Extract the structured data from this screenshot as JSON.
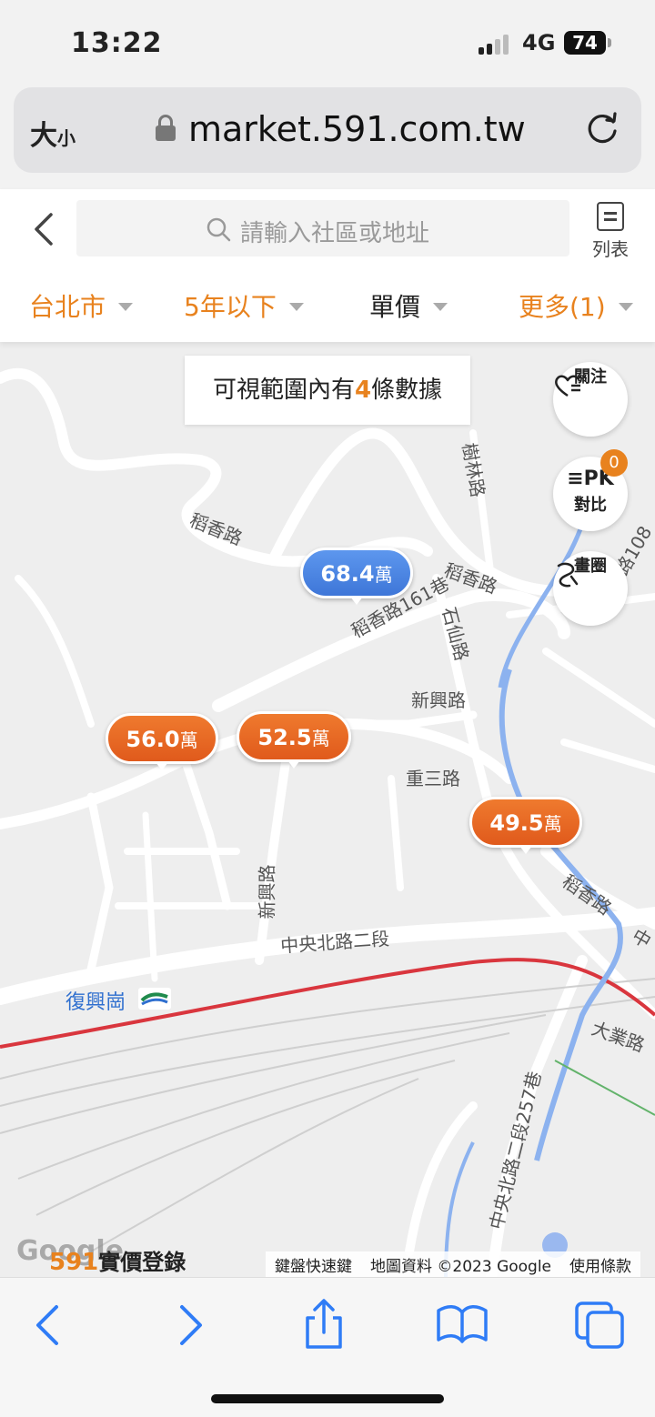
{
  "status": {
    "time": "13:22",
    "network": "4G",
    "battery": "74"
  },
  "browser": {
    "text_size_label": "大",
    "text_size_small": "小",
    "url": "market.591.com.tw"
  },
  "header": {
    "search_placeholder": "請輸入社區或地址",
    "list_label": "列表",
    "filters": [
      {
        "label": "台北市",
        "active": true
      },
      {
        "label": "5年以下",
        "active": true
      },
      {
        "label": "單價",
        "active": false
      },
      {
        "label": "更多(1)",
        "active": true
      }
    ]
  },
  "map": {
    "count_prefix": "可視範圍內有",
    "count_value": "4",
    "count_suffix": "條數據",
    "actions": {
      "follow": "關注",
      "compare": "對比",
      "compare_badge": "0",
      "draw": "畫圈"
    },
    "markers": [
      {
        "value": "68.4",
        "unit": "萬"
      },
      {
        "value": "56.0",
        "unit": "萬"
      },
      {
        "value": "52.5",
        "unit": "萬"
      },
      {
        "value": "49.5",
        "unit": "萬"
      }
    ],
    "roads": {
      "r1": "稻香路",
      "r2": "稻香路161巷",
      "r3": "稻香路",
      "r4": "石仙路",
      "r5": "樹林路",
      "r6": "新興路",
      "r7": "重三路",
      "r8": "新興路",
      "r9": "中央北路二段",
      "r10": "稻香路",
      "r11": "大業路",
      "r12": "中央北路二段257巷",
      "r13": "路108",
      "r14": "中"
    },
    "station": "復興崗",
    "google": "Google",
    "logo_591": "591",
    "logo_text": "實價登錄",
    "attribution": {
      "keys": "鍵盤快速鍵",
      "data": "地圖資料 ©2023 Google",
      "terms": "使用條款"
    }
  },
  "colors": {
    "accent": "#e8821e",
    "marker_orange": "#e8651f",
    "marker_blue": "#4a86e4",
    "ios_blue": "#1a73e8"
  }
}
